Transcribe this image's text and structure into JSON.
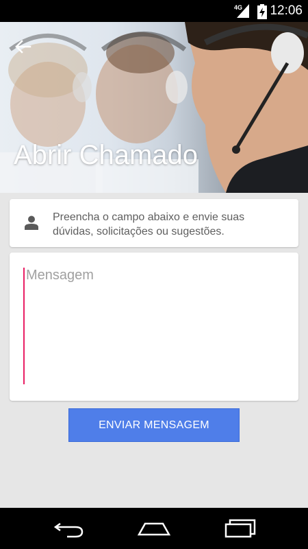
{
  "status_bar": {
    "network": "4G",
    "time": "12:06",
    "icons": [
      "signal-icon",
      "battery-charging-icon"
    ]
  },
  "header": {
    "title": "Abrir Chamado",
    "back_icon": "arrow-back-icon",
    "image": "call-center-agents-with-headsets-photo"
  },
  "info_card": {
    "icon": "person-icon",
    "text": "Preencha o campo abaixo e envie suas dúvidas, solicitações ou sugestões."
  },
  "message_field": {
    "placeholder": "Mensagem",
    "value": ""
  },
  "send_button": {
    "label": "ENVIAR MENSAGEM"
  },
  "nav_bar": {
    "icons": [
      "back-icon",
      "home-icon",
      "recent-apps-icon"
    ]
  },
  "colors": {
    "accent": "#4f7ee9",
    "cursor": "#e91e63",
    "background": "#e6e6e6"
  }
}
